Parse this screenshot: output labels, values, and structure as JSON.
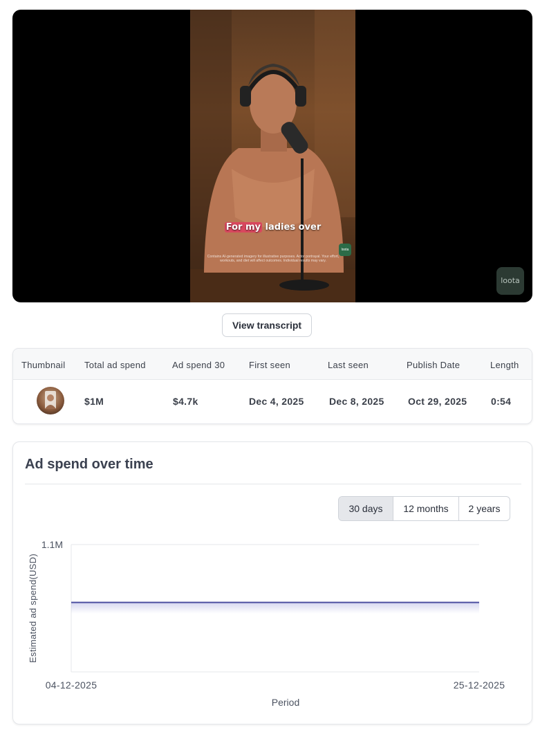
{
  "video": {
    "caption_highlight": "For my",
    "caption_rest": " ladies over",
    "disclaimer": "Contains AI-generated imagery for illustrative purposes. Actor portrayal. Your effort, workouts, and diet will affect outcomes. Individual results may vary.",
    "brand_small": "loota",
    "watermark": "loota"
  },
  "actions": {
    "view_transcript": "View transcript"
  },
  "stats": {
    "headers": [
      "Thumbnail",
      "Total ad spend",
      "Ad spend 30",
      "First seen",
      "Last seen",
      "Publish Date",
      "Length"
    ],
    "row": {
      "total_ad_spend": "$1M",
      "ad_spend_30": "$4.7k",
      "first_seen": "Dec 4, 2025",
      "last_seen": "Dec 8, 2025",
      "publish_date": "Oct 29, 2025",
      "length": "0:54"
    }
  },
  "chart_card": {
    "title": "Ad spend over time",
    "ranges": [
      {
        "label": "30 days",
        "active": true
      },
      {
        "label": "12 months",
        "active": false
      },
      {
        "label": "2 years",
        "active": false
      }
    ]
  },
  "colors": {
    "line": "#4b4fa0",
    "accent_active": "#e5e7eb"
  },
  "chart_data": {
    "type": "area",
    "title": "",
    "xlabel": "Period",
    "ylabel": "Estimated ad spend(USD)",
    "x": [
      "04-12-2025",
      "25-12-2025"
    ],
    "series": [
      {
        "values": [
          600000,
          600000
        ]
      }
    ],
    "ylim": [
      0,
      1100000
    ],
    "y_tick_labels": [
      "1.1M"
    ],
    "grid": true,
    "legend": "none"
  }
}
